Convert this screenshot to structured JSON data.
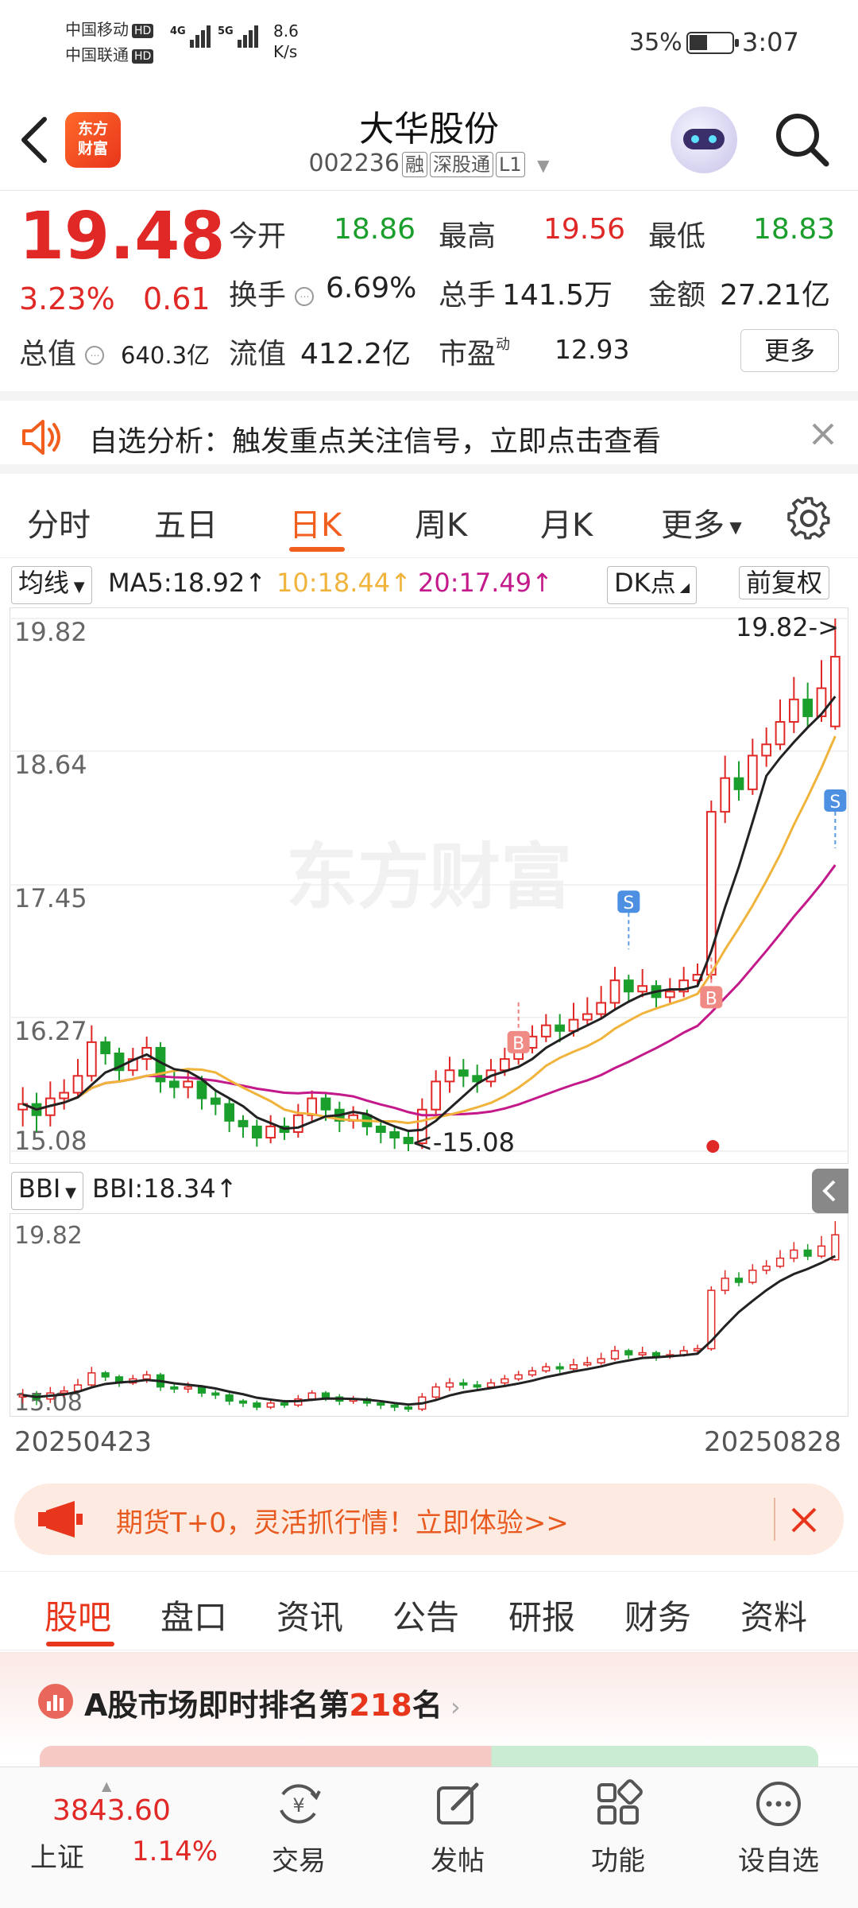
{
  "status": {
    "carrier1": "中国移动",
    "carrier2": "中国联通",
    "hd": "HD",
    "net1": "4G",
    "net2": "5G",
    "speed_value": "8.6",
    "speed_unit": "K/s",
    "battery": "35%",
    "time": "3:07"
  },
  "header": {
    "logo_line1": "东方",
    "logo_line2": "财富",
    "title": "大华股份",
    "code": "002236",
    "tag_rong": "融",
    "tag_sgt": "深股通",
    "tag_l1": "L1"
  },
  "quote": {
    "price": "19.48",
    "change_pct": "3.23%",
    "change": "0.61",
    "open_label": "今开",
    "open": "18.86",
    "high_label": "最高",
    "high": "19.56",
    "low_label": "最低",
    "low": "18.83",
    "turnover_label": "换手",
    "turnover": "6.69%",
    "volume_label": "总手",
    "volume": "141.5万",
    "amount_label": "金额",
    "amount": "27.21亿",
    "mktcap_label": "总值",
    "mktcap": "640.3亿",
    "float_label": "流值",
    "float": "412.2亿",
    "pe_label": "市盈",
    "pe_sup": "动",
    "pe": "12.93",
    "more": "更多"
  },
  "alert": {
    "text": "自选分析：触发重点关注信号，立即点击查看"
  },
  "period_tabs": [
    "分时",
    "五日",
    "日K",
    "周K",
    "月K",
    "更多"
  ],
  "ma_row": {
    "selector": "均线",
    "ma5": "MA5:18.92",
    "ma10": "10:18.44",
    "ma20": "20:17.49",
    "dk": "DK点",
    "fq": "前复权",
    "ma5_color": "#222222",
    "ma10_color": "#f0b43c",
    "ma20_color": "#c4198a"
  },
  "chart_data": [
    {
      "type": "candlestick",
      "y_ticks": [
        "19.82",
        "18.64",
        "17.45",
        "16.27",
        "15.08"
      ],
      "ylim": [
        15.08,
        19.82
      ],
      "max_label": "19.82->",
      "min_label": "<-15.08",
      "watermark": "东方财富",
      "markers": [
        "B",
        "S",
        "B",
        "S"
      ],
      "candles": [
        [
          15.45,
          15.5,
          15.3,
          15.65
        ],
        [
          15.5,
          15.4,
          15.25,
          15.6
        ],
        [
          15.4,
          15.55,
          15.3,
          15.7
        ],
        [
          15.55,
          15.6,
          15.45,
          15.72
        ],
        [
          15.6,
          15.75,
          15.55,
          15.9
        ],
        [
          15.75,
          16.05,
          15.7,
          16.2
        ],
        [
          16.05,
          15.95,
          15.85,
          16.1
        ],
        [
          15.95,
          15.8,
          15.7,
          16.0
        ],
        [
          15.8,
          15.9,
          15.75,
          16.0
        ],
        [
          15.9,
          16.0,
          15.8,
          16.1
        ],
        [
          16.0,
          15.7,
          15.6,
          16.05
        ],
        [
          15.7,
          15.65,
          15.55,
          15.8
        ],
        [
          15.65,
          15.7,
          15.55,
          15.82
        ],
        [
          15.7,
          15.55,
          15.45,
          15.75
        ],
        [
          15.55,
          15.5,
          15.4,
          15.62
        ],
        [
          15.5,
          15.35,
          15.25,
          15.55
        ],
        [
          15.35,
          15.3,
          15.2,
          15.4
        ],
        [
          15.3,
          15.2,
          15.12,
          15.36
        ],
        [
          15.2,
          15.3,
          15.15,
          15.4
        ],
        [
          15.3,
          15.25,
          15.18,
          15.38
        ],
        [
          15.25,
          15.4,
          15.2,
          15.5
        ],
        [
          15.4,
          15.55,
          15.35,
          15.62
        ],
        [
          15.55,
          15.45,
          15.35,
          15.6
        ],
        [
          15.45,
          15.35,
          15.25,
          15.52
        ],
        [
          15.35,
          15.4,
          15.28,
          15.48
        ],
        [
          15.4,
          15.3,
          15.22,
          15.45
        ],
        [
          15.3,
          15.25,
          15.15,
          15.35
        ],
        [
          15.25,
          15.2,
          15.1,
          15.3
        ],
        [
          15.2,
          15.15,
          15.08,
          15.25
        ],
        [
          15.15,
          15.45,
          15.1,
          15.55
        ],
        [
          15.45,
          15.7,
          15.4,
          15.8
        ],
        [
          15.7,
          15.8,
          15.6,
          15.92
        ],
        [
          15.8,
          15.75,
          15.65,
          15.9
        ],
        [
          15.75,
          15.7,
          15.6,
          15.85
        ],
        [
          15.7,
          15.8,
          15.65,
          15.9
        ],
        [
          15.8,
          15.9,
          15.75,
          16.0
        ],
        [
          15.9,
          16.0,
          15.85,
          16.1
        ],
        [
          16.0,
          16.1,
          15.95,
          16.2
        ],
        [
          16.1,
          16.2,
          16.05,
          16.3
        ],
        [
          16.2,
          16.15,
          16.05,
          16.3
        ],
        [
          16.15,
          16.25,
          16.1,
          16.4
        ],
        [
          16.25,
          16.3,
          16.2,
          16.45
        ],
        [
          16.3,
          16.4,
          16.25,
          16.55
        ],
        [
          16.4,
          16.6,
          16.35,
          16.72
        ],
        [
          16.6,
          16.5,
          16.4,
          16.65
        ],
        [
          16.5,
          16.55,
          16.45,
          16.7
        ],
        [
          16.55,
          16.45,
          16.35,
          16.6
        ],
        [
          16.45,
          16.5,
          16.4,
          16.62
        ],
        [
          16.5,
          16.6,
          16.45,
          16.72
        ],
        [
          16.6,
          16.65,
          16.55,
          16.75
        ],
        [
          16.65,
          18.1,
          16.6,
          18.2
        ],
        [
          18.1,
          18.4,
          18.0,
          18.6
        ],
        [
          18.4,
          18.3,
          18.2,
          18.55
        ],
        [
          18.3,
          18.6,
          18.25,
          18.75
        ],
        [
          18.6,
          18.7,
          18.5,
          18.85
        ],
        [
          18.7,
          18.9,
          18.65,
          19.1
        ],
        [
          18.9,
          19.1,
          18.8,
          19.3
        ],
        [
          19.1,
          18.95,
          18.85,
          19.25
        ],
        [
          18.95,
          19.2,
          18.9,
          19.45
        ],
        [
          18.86,
          19.48,
          18.83,
          19.82
        ]
      ]
    },
    {
      "type": "line",
      "indicator": "BBI",
      "selector": "BBI",
      "value_label": "BBI:18.34",
      "y_ticks": [
        "19.82",
        "15.08"
      ],
      "ylim": [
        15.08,
        19.82
      ],
      "x_start": "20250423",
      "x_end": "20250828"
    }
  ],
  "promo": {
    "text": "期货T+0，灵活抓行情！立即体验>>"
  },
  "content_tabs": [
    "股吧",
    "盘口",
    "资讯",
    "公告",
    "研报",
    "财务",
    "资料"
  ],
  "rank": {
    "prefix": "A股市场即时排名第",
    "number": "218",
    "suffix": "名"
  },
  "bottom_nav": {
    "index_value": "3843.60",
    "index_name": "上证",
    "index_change": "1.14%",
    "trade": "交易",
    "post": "发帖",
    "func": "功能",
    "watch": "设自选"
  }
}
